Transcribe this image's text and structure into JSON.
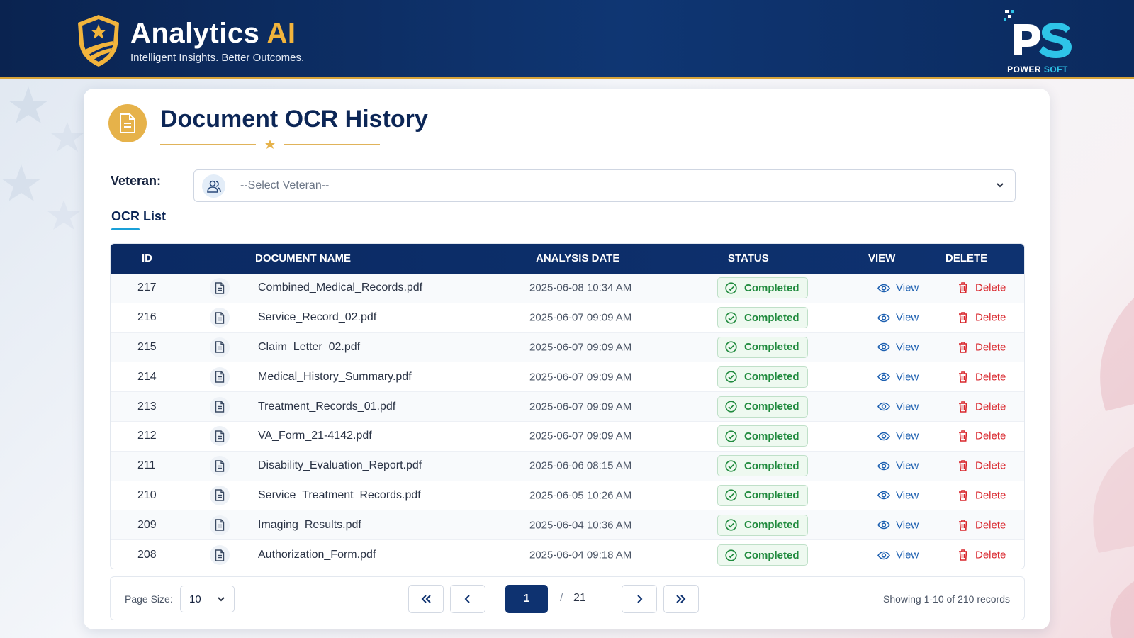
{
  "header": {
    "brand_title_main": "Analytics",
    "brand_title_accent": "AI",
    "brand_subtitle": "Intelligent Insights. Better Outcomes.",
    "partner_logo_main": "POWER",
    "partner_logo_accent": "SOFT",
    "partner_logo_letters": "PS"
  },
  "page": {
    "title": "Document OCR History",
    "title_icon": "document-icon"
  },
  "filter": {
    "label": "Veteran:",
    "placeholder": "--Select Veteran--"
  },
  "tabs": [
    {
      "label": "OCR List",
      "active": true
    }
  ],
  "table": {
    "columns": [
      "ID",
      "DOCUMENT NAME",
      "ANALYSIS DATE",
      "STATUS",
      "VIEW",
      "DELETE"
    ],
    "rows": [
      {
        "id": "217",
        "name": "Combined_Medical_Records.pdf",
        "date": "2025-06-08 10:34 AM",
        "status": "Completed",
        "view": "View",
        "delete": "Delete"
      },
      {
        "id": "216",
        "name": "Service_Record_02.pdf",
        "date": "2025-06-07 09:09 AM",
        "status": "Completed",
        "view": "View",
        "delete": "Delete"
      },
      {
        "id": "215",
        "name": "Claim_Letter_02.pdf",
        "date": "2025-06-07 09:09 AM",
        "status": "Completed",
        "view": "View",
        "delete": "Delete"
      },
      {
        "id": "214",
        "name": "Medical_History_Summary.pdf",
        "date": "2025-06-07 09:09 AM",
        "status": "Completed",
        "view": "View",
        "delete": "Delete"
      },
      {
        "id": "213",
        "name": "Treatment_Records_01.pdf",
        "date": "2025-06-07 09:09 AM",
        "status": "Completed",
        "view": "View",
        "delete": "Delete"
      },
      {
        "id": "212",
        "name": "VA_Form_21-4142.pdf",
        "date": "2025-06-07 09:09 AM",
        "status": "Completed",
        "view": "View",
        "delete": "Delete"
      },
      {
        "id": "211",
        "name": "Disability_Evaluation_Report.pdf",
        "date": "2025-06-06 08:15 AM",
        "status": "Completed",
        "view": "View",
        "delete": "Delete"
      },
      {
        "id": "210",
        "name": "Service_Treatment_Records.pdf",
        "date": "2025-06-05 10:26 AM",
        "status": "Completed",
        "view": "View",
        "delete": "Delete"
      },
      {
        "id": "209",
        "name": "Imaging_Results.pdf",
        "date": "2025-06-04 10:36 AM",
        "status": "Completed",
        "view": "View",
        "delete": "Delete"
      },
      {
        "id": "208",
        "name": "Authorization_Form.pdf",
        "date": "2025-06-04 09:18 AM",
        "status": "Completed",
        "view": "View",
        "delete": "Delete"
      }
    ]
  },
  "pagination": {
    "page_size_label": "Page Size:",
    "page_size": "10",
    "current_page": "1",
    "separator": "/",
    "total_pages": "21",
    "info": "Showing 1-10 of 210 records"
  },
  "colors": {
    "header_bg": "#0b2a63",
    "accent_gold": "#e6b24a",
    "status_green": "#1f8a3d",
    "link_blue": "#1c5fb0",
    "delete_red": "#d9262c"
  }
}
